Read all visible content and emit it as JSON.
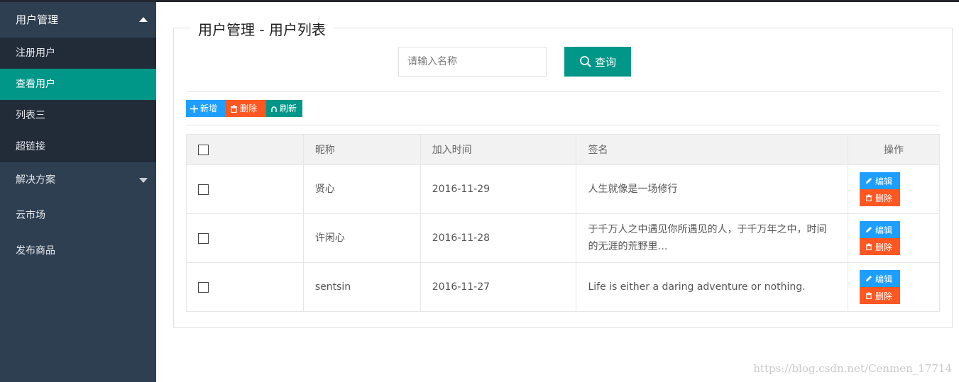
{
  "sidebar": {
    "group1": {
      "label": "用户管理"
    },
    "sub_items": [
      {
        "label": "注册用户"
      },
      {
        "label": "查看用户"
      },
      {
        "label": "列表三"
      },
      {
        "label": "超链接"
      }
    ],
    "group2": {
      "label": "解决方案"
    },
    "group3": {
      "label": "云市场"
    },
    "group4": {
      "label": "发布商品"
    }
  },
  "panel": {
    "title": "用户管理 - 用户列表",
    "search_placeholder": "请输入名称",
    "search_label": "查询"
  },
  "toolbar": {
    "add_label": "新增",
    "delete_label": "删除",
    "refresh_label": "刷新"
  },
  "table": {
    "headers": {
      "nickname": "昵称",
      "join_time": "加入时间",
      "signature": "签名",
      "actions": "操作"
    },
    "rows": [
      {
        "nickname": "贤心",
        "join_time": "2016-11-29",
        "signature": "人生就像是一场修行"
      },
      {
        "nickname": "许闲心",
        "join_time": "2016-11-28",
        "signature": "于千万人之中遇见你所遇见的人，于千万年之中，时间的无涯的荒野里…"
      },
      {
        "nickname": "sentsin",
        "join_time": "2016-11-27",
        "signature": "Life is either a daring adventure or nothing."
      }
    ],
    "edit_label": "编辑",
    "delete_label": "删除"
  },
  "watermark": "https://blog.csdn.net/Cenmen_17714",
  "colors": {
    "sidebar_bg": "#2f3f52",
    "active": "#009688",
    "blue": "#1e9fff",
    "orange": "#ff5722"
  }
}
